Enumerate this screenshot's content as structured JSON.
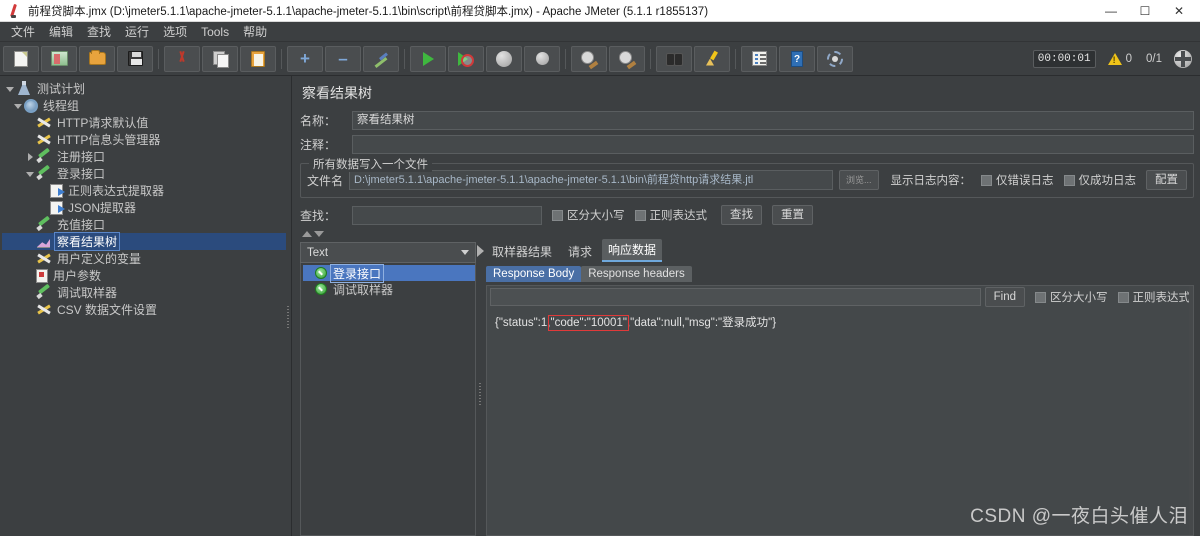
{
  "window": {
    "title": "前程贷脚本.jmx (D:\\jmeter5.1.1\\apache-jmeter-5.1.1\\apache-jmeter-5.1.1\\bin\\script\\前程贷脚本.jmx) - Apache JMeter (5.1.1 r1855137)",
    "minimize": "—",
    "maximize": "☐",
    "close": "✕"
  },
  "menubar": {
    "items": [
      {
        "label": "文件"
      },
      {
        "label": "编辑"
      },
      {
        "label": "查找"
      },
      {
        "label": "运行"
      },
      {
        "label": "选项"
      },
      {
        "label": "Tools"
      },
      {
        "label": "帮助"
      }
    ]
  },
  "toolbar": {
    "buttons": [
      {
        "name": "new-button",
        "icon": "new-document-icon"
      },
      {
        "name": "templates-button",
        "icon": "templates-icon"
      },
      {
        "name": "open-button",
        "icon": "open-folder-icon"
      },
      {
        "name": "save-button",
        "icon": "save-disk-icon"
      },
      {
        "name": "cut-button",
        "icon": "scissors-icon"
      },
      {
        "name": "copy-button",
        "icon": "copy-icon"
      },
      {
        "name": "paste-button",
        "icon": "clipboard-icon"
      },
      {
        "name": "expand-all-button",
        "icon": "plus-icon"
      },
      {
        "name": "collapse-all-button",
        "icon": "minus-icon"
      },
      {
        "name": "toggle-button",
        "icon": "toggle-icon"
      },
      {
        "name": "start-button",
        "icon": "play-icon"
      },
      {
        "name": "start-no-pauses-button",
        "icon": "play-no-pauses-icon"
      },
      {
        "name": "stop-button",
        "icon": "stop-circle-icon"
      },
      {
        "name": "shutdown-button",
        "icon": "shutdown-circle-icon"
      },
      {
        "name": "clear-button",
        "icon": "clear-icon"
      },
      {
        "name": "clear-all-button",
        "icon": "clear-all-icon"
      },
      {
        "name": "search-button",
        "icon": "binoculars-icon"
      },
      {
        "name": "reset-search-button",
        "icon": "brush-icon"
      },
      {
        "name": "function-helper-button",
        "icon": "list-icon"
      },
      {
        "name": "help-button",
        "icon": "help-book-icon"
      },
      {
        "name": "ssl-manager-button",
        "icon": "network-icon"
      }
    ],
    "timer": "00:00:01",
    "warning_count": "0",
    "thread_count": "0/1",
    "plus_glyph": "+",
    "minus_glyph": "–",
    "help_glyph": "?"
  },
  "tree": {
    "nodes": [
      {
        "label": "测试计划",
        "indent": 0,
        "arrow": "down",
        "icon": "test-plan-icon",
        "selected": false
      },
      {
        "label": "线程组",
        "indent": 1,
        "arrow": "down",
        "icon": "thread-group-icon",
        "selected": false
      },
      {
        "label": "HTTP请求默认值",
        "indent": 2,
        "arrow": "none",
        "icon": "config-element-icon",
        "selected": false
      },
      {
        "label": "HTTP信息头管理器",
        "indent": 2,
        "arrow": "none",
        "icon": "config-element-icon",
        "selected": false
      },
      {
        "label": "注册接口",
        "indent": 2,
        "arrow": "right",
        "icon": "sampler-icon",
        "selected": false
      },
      {
        "label": "登录接口",
        "indent": 2,
        "arrow": "down",
        "icon": "sampler-icon",
        "selected": false
      },
      {
        "label": "正则表达式提取器",
        "indent": 3,
        "arrow": "none",
        "icon": "post-processor-icon",
        "selected": false
      },
      {
        "label": "JSON提取器",
        "indent": 3,
        "arrow": "none",
        "icon": "post-processor-icon",
        "selected": false
      },
      {
        "label": "充值接口",
        "indent": 2,
        "arrow": "none",
        "icon": "sampler-icon",
        "selected": false
      },
      {
        "label": "察看结果树",
        "indent": 2,
        "arrow": "none",
        "icon": "view-results-tree-icon",
        "selected": true
      },
      {
        "label": "用户定义的变量",
        "indent": 2,
        "arrow": "none",
        "icon": "config-element-icon",
        "selected": false
      },
      {
        "label": "用户参数",
        "indent": 2,
        "arrow": "none",
        "icon": "user-parameters-icon",
        "selected": false
      },
      {
        "label": "调试取样器",
        "indent": 2,
        "arrow": "none",
        "icon": "sampler-icon",
        "selected": false
      },
      {
        "label": "CSV 数据文件设置",
        "indent": 2,
        "arrow": "none",
        "icon": "config-element-icon",
        "selected": false
      }
    ]
  },
  "panel": {
    "title": "察看结果树",
    "name_label": "名称：",
    "name_value": "察看结果树",
    "comment_label": "注释：",
    "comment_value": "",
    "filegroup": {
      "legend": "所有数据写入一个文件",
      "file_label": "文件名",
      "file_value": "D:\\jmeter5.1.1\\apache-jmeter-5.1.1\\apache-jmeter-5.1.1\\bin\\前程贷http请求结果.jtl",
      "browse_label": "浏览...",
      "log_display_label": "显示日志内容：",
      "errors_only_label": "仅错误日志",
      "success_only_label": "仅成功日志",
      "configure_label": "配置"
    },
    "search": {
      "label": "查找：",
      "value": "",
      "case_sensitive_label": "区分大小写",
      "regexp_label": "正则表达式",
      "find_label": "查找",
      "reset_label": "重置"
    }
  },
  "results": {
    "renderer": "Text",
    "samplers": [
      {
        "label": "登录接口",
        "status": "success",
        "selected": true
      },
      {
        "label": "调试取样器",
        "status": "success",
        "selected": false
      }
    ],
    "tabs": [
      {
        "label": "取样器结果",
        "active": false
      },
      {
        "label": "请求",
        "active": false
      },
      {
        "label": "响应数据",
        "active": true
      }
    ],
    "subtabs": [
      {
        "label": "Response Body",
        "active": true
      },
      {
        "label": "Response headers",
        "active": false
      }
    ],
    "find": {
      "value": "",
      "find_label": "Find",
      "case_sensitive_label": "区分大小写",
      "regexp_label": "正则表达式"
    },
    "response_body": {
      "prefix": "{\"status\":1,",
      "highlight": "\"code\":\"10001\"",
      "suffix": ",\"data\":null,\"msg\":\"登录成功\"}"
    }
  },
  "watermark": "CSDN @一夜白头催人泪",
  "colors": {
    "accent_selection": "#2b4b7d",
    "tab_accent": "#6fa8dc",
    "highlight_border": "#e03a3a",
    "background": "#3c3f41"
  }
}
